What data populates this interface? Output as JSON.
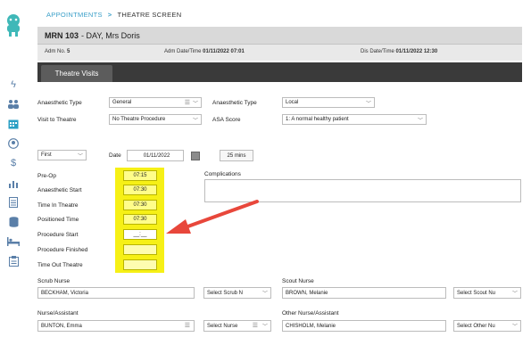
{
  "breadcrumb": {
    "parent": "APPOINTMENTS",
    "separator": ">",
    "current": "THEATRE SCREEN"
  },
  "patient": {
    "mrn_label": "MRN 103",
    "name": "- DAY, Mrs Doris"
  },
  "info": {
    "adm_label": "Adm No.",
    "adm_value": "5",
    "adm_dt_label": "Adm Date/Time",
    "adm_dt_value": "01/11/2022 07:01",
    "dis_dt_label": "Dis Date/Time",
    "dis_dt_value": "01/11/2022 12:30"
  },
  "tabs": {
    "active": "Theatre Visits"
  },
  "form": {
    "anaesthetic_type_label": "Anaesthetic Type",
    "anaesthetic_type_value": "General",
    "anaesthetic_type2_label": "Anaesthetic Type",
    "anaesthetic_type2_value": "Local",
    "visit_label": "Visit to Theatre",
    "visit_value": "No Theatre Procedure",
    "asa_label": "ASA Score",
    "asa_value": "1: A normal healthy patient",
    "order_value": "First",
    "date_label": "Date",
    "date_value": "01/11/2022",
    "duration_button": "25 mins",
    "complications_label": "Complications"
  },
  "times": [
    {
      "label": "Pre-Op",
      "value": "07:15"
    },
    {
      "label": "Anaesthetic Start",
      "value": "07:30"
    },
    {
      "label": "Time In Theatre",
      "value": "07:30"
    },
    {
      "label": "Positioned Time",
      "value": "07:30"
    },
    {
      "label": "Procedure Start",
      "value": "__:__"
    },
    {
      "label": "Procedure Finished",
      "value": ""
    },
    {
      "label": "Time Out Theatre",
      "value": ""
    }
  ],
  "staff": {
    "scrub_label": "Scrub Nurse",
    "scrub_value": "BECKHAM, Victoria",
    "scrub_select": "Select Scrub N",
    "scout_label": "Scout Nurse",
    "scout_value": "BROWN, Melanie",
    "scout_select": "Select Scout Nu",
    "assist_label": "Nurse/Assistant",
    "assist_value": "BUNTON, Emma",
    "assist_select": "Select Nurse",
    "other_label": "Other Nurse/Assistant",
    "other_value": "CHISHOLM, Melanie",
    "other_select": "Select Other Nu"
  },
  "colors": {
    "accent": "#3a9fc8",
    "highlight": "#f6f016",
    "arrow": "#e8473b",
    "tabbar": "#3a3a3a"
  },
  "icons": [
    "logo-icon",
    "bolt-icon",
    "group-icon",
    "calendar-icon",
    "user-circle-icon",
    "dollar-icon",
    "chart-icon",
    "document-icon",
    "database-icon",
    "bed-icon",
    "clipboard-icon"
  ]
}
